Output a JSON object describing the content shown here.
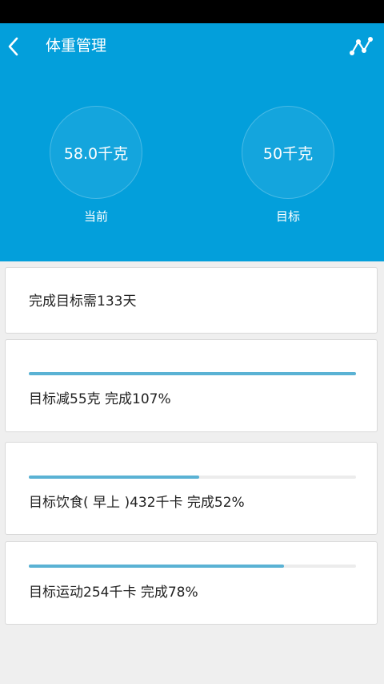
{
  "app": {
    "title": "体重管理",
    "accent_color": "#039fdb",
    "back_icon": "chevron-left-icon",
    "chart_icon": "line-chart-icon"
  },
  "stats": {
    "current": {
      "value": "58.0千克",
      "label": "当前"
    },
    "target": {
      "value": "50千克",
      "label": "目标"
    }
  },
  "days_card": {
    "text": "完成目标需133天"
  },
  "progress_cards": [
    {
      "text": "目标减55克 完成107%",
      "progress": 1.0
    },
    {
      "text": "目标饮食( 早上 )432千卡 完成52%",
      "progress": 0.52
    },
    {
      "text": "目标运动254千卡 完成78%",
      "progress": 0.78
    }
  ]
}
